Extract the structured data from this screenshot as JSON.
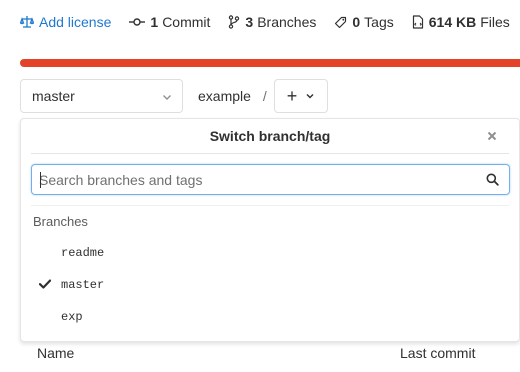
{
  "stats": {
    "add_license": "Add license",
    "commits_count": "1",
    "commits_label": "Commit",
    "branches_count": "3",
    "branches_label": "Branches",
    "tags_count": "0",
    "tags_label": "Tags",
    "files_size": "614 KB",
    "files_label": "Files"
  },
  "ref": {
    "selected": "master",
    "path_root": "example",
    "path_sep": "/",
    "add_label": "+"
  },
  "dropdown": {
    "title": "Switch branch/tag",
    "search_placeholder": "Search branches and tags",
    "section_label": "Branches",
    "branches": [
      {
        "name": "readme",
        "checked": false
      },
      {
        "name": "master",
        "checked": true
      },
      {
        "name": "exp",
        "checked": false
      }
    ]
  },
  "table": {
    "col_name": "Name",
    "col_last_commit": "Last commit"
  },
  "colors": {
    "link": "#1f78d1",
    "language_bar": "#e24329",
    "focus_border": "#73afea"
  }
}
